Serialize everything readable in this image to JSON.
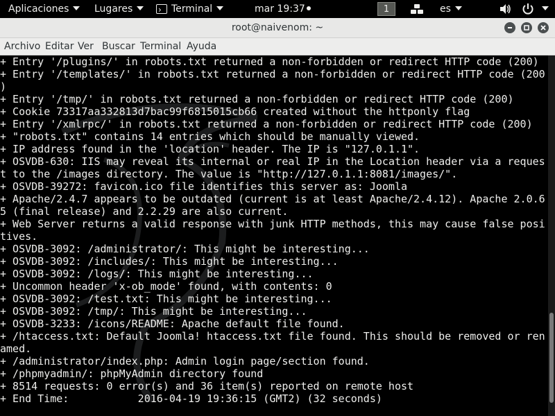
{
  "topbar": {
    "applications": "Aplicaciones",
    "places": "Lugares",
    "app_name": "Terminal",
    "clock": "mar 19:37",
    "workspace": "1",
    "language": "es"
  },
  "window": {
    "title": "root@naivenom: ~"
  },
  "menubar": {
    "items": [
      "Archivo",
      "Editar",
      "Ver",
      "Buscar",
      "Terminal",
      "Ayuda"
    ]
  },
  "terminal": {
    "lines": [
      "+ Entry '/plugins/' in robots.txt returned a non-forbidden or redirect HTTP code (200)",
      "+ Entry '/templates/' in robots.txt returned a non-forbidden or redirect HTTP code (200",
      ")",
      "+ Entry '/tmp/' in robots.txt returned a non-forbidden or redirect HTTP code (200)",
      "+ Cookie 73317aa332813d7bac99f6815015cb66 created without the httponly flag",
      "+ Entry '/xmlrpc/' in robots.txt returned a non-forbidden or redirect HTTP code (200)",
      "+ \"robots.txt\" contains 14 entries which should be manually viewed.",
      "+ IP address found in the 'location' header. The IP is \"127.0.1.1\".",
      "+ OSVDB-630: IIS may reveal its internal or real IP in the Location header via a reques",
      "t to the /images directory. The value is \"http://127.0.1.1:8081/images/\".",
      "+ OSVDB-39272: favicon.ico file identifies this server as: Joomla",
      "+ Apache/2.4.7 appears to be outdated (current is at least Apache/2.4.12). Apache 2.0.6",
      "5 (final release) and 2.2.29 are also current.",
      "+ Web Server returns a valid response with junk HTTP methods, this may cause false posi",
      "tives.",
      "+ OSVDB-3092: /administrator/: This might be interesting...",
      "+ OSVDB-3092: /includes/: This might be interesting...",
      "+ OSVDB-3092: /logs/: This might be interesting...",
      "+ Uncommon header 'x-ob_mode' found, with contents: 0",
      "+ OSVDB-3092: /test.txt: This might be interesting...",
      "+ OSVDB-3092: /tmp/: This might be interesting...",
      "+ OSVDB-3233: /icons/README: Apache default file found.",
      "+ /htaccess.txt: Default Joomla! htaccess.txt file found. This should be removed or ren",
      "amed.",
      "+ /administrator/index.php: Admin login page/section found.",
      "+ /phpmyadmin/: phpMyAdmin directory found",
      "+ 8514 requests: 0 error(s) and 36 item(s) reported on remote host",
      "+ End Time:           2016-04-19 19:36:15 (GMT2) (32 seconds)"
    ],
    "scroll_position": 0.95,
    "scroll_visible_fraction": 0.25
  },
  "icons": {
    "network": "network-icon",
    "volume": "volume-icon",
    "power": "power-icon",
    "minimize": "minimize-icon",
    "maximize": "maximize-icon",
    "close": "close-icon"
  }
}
